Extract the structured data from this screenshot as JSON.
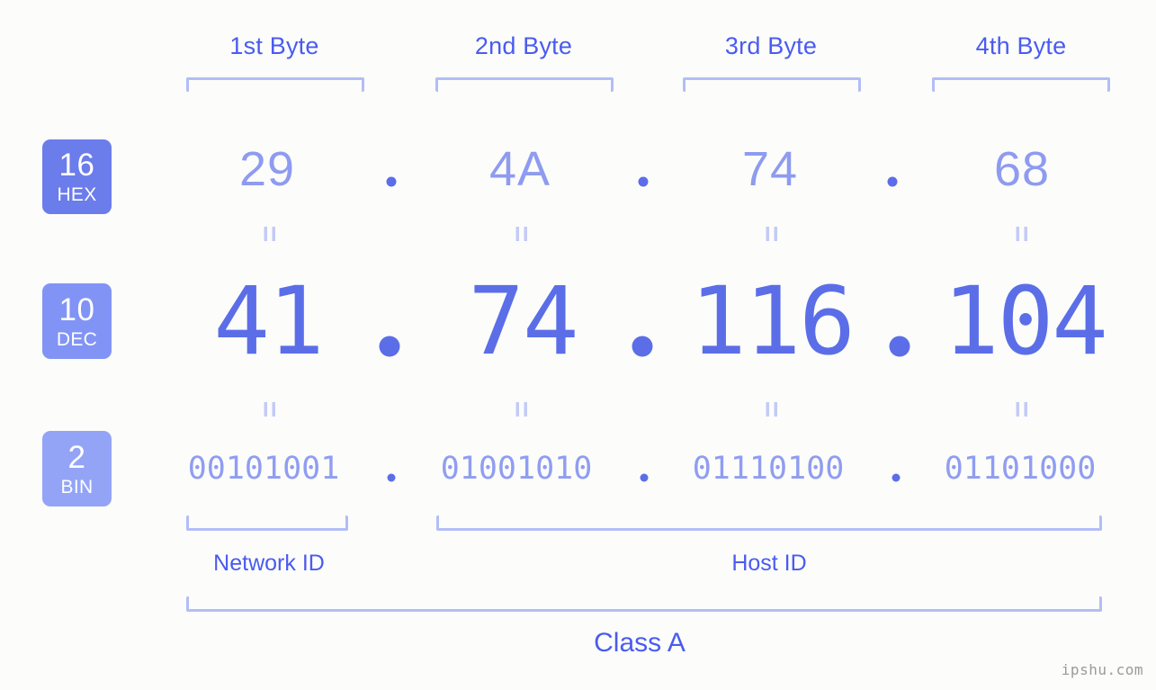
{
  "background_color": "#fcfdfa",
  "accent_colors": {
    "header_text": "#4a5bf0",
    "bracket": "#b3bdf7",
    "hex_value": "#8e9bf0",
    "dec_value": "#5b6ee8",
    "bin_value": "#909df2",
    "badge_dark": "#6b7ceb",
    "badge_light": "#93a4f7",
    "equals": "#c3cbf8",
    "watermark": "#9a9a9a"
  },
  "byte_headers": [
    {
      "label": "1st Byte"
    },
    {
      "label": "2nd Byte"
    },
    {
      "label": "3rd Byte"
    },
    {
      "label": "4th Byte"
    }
  ],
  "rows": [
    {
      "id": "hex",
      "badge": {
        "number": "16",
        "name": "HEX"
      },
      "values": [
        "29",
        "4A",
        "74",
        "68"
      ],
      "separator": "."
    },
    {
      "id": "dec",
      "badge": {
        "number": "10",
        "name": "DEC"
      },
      "values": [
        "41",
        "74",
        "116",
        "104"
      ],
      "separator": "."
    },
    {
      "id": "bin",
      "badge": {
        "number": "2",
        "name": "BIN"
      },
      "values": [
        "00101001",
        "01001010",
        "01110100",
        "01101000"
      ],
      "separator": "."
    }
  ],
  "equals_symbol": "=",
  "sections": [
    {
      "label": "Network ID"
    },
    {
      "label": "Host ID"
    }
  ],
  "class": {
    "label": "Class A"
  },
  "watermark": {
    "text": "ipshu.com"
  }
}
